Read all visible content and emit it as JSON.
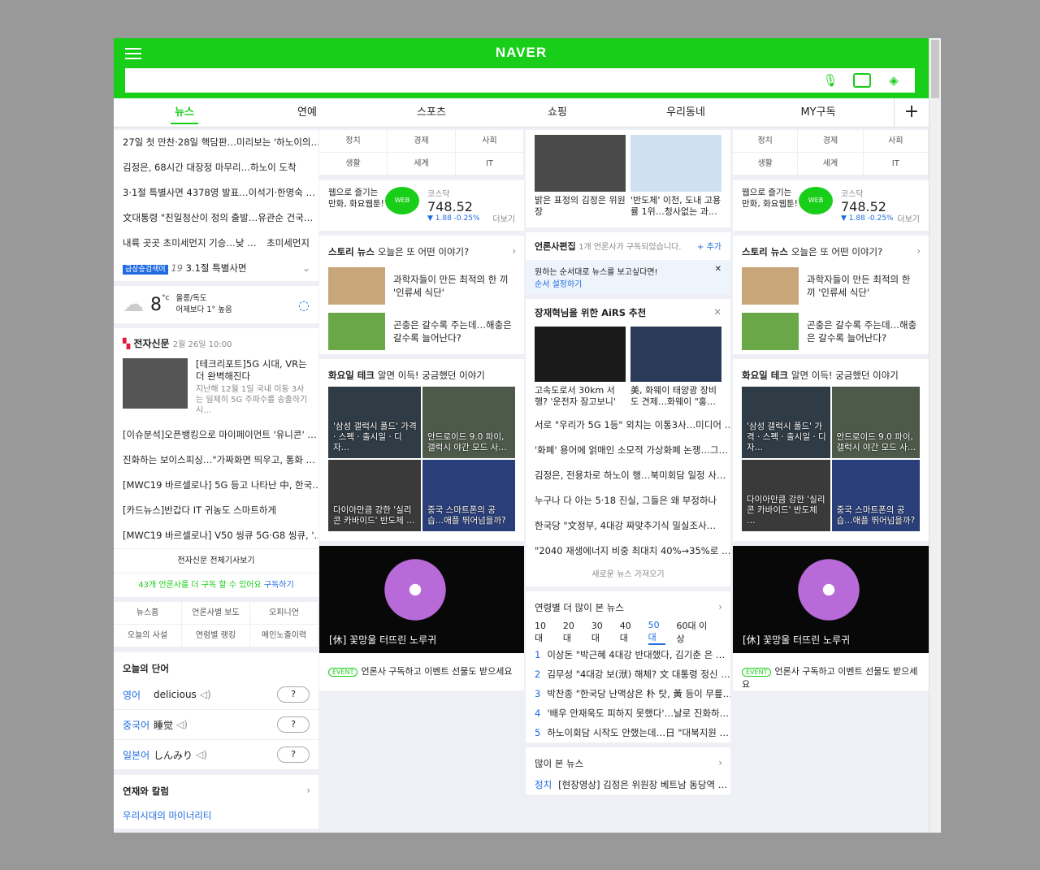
{
  "header": {
    "logo": "NAVER",
    "search_placeholder": ""
  },
  "tabs": [
    "뉴스",
    "연예",
    "스포츠",
    "쇼핑",
    "우리동네",
    "MY구독"
  ],
  "col1": {
    "headlines": [
      "27일 첫 만찬·28일 핵담판…미리보는 '하노이의…",
      "김정은, 68시간 대장정 마무리…하노이 도착",
      "3·1절 특별사면 4378명 발표…이석기·한명숙 …",
      "文대통령 \"친일청산이 정의 출발…유관순 건국…",
      "내륙 곳곳 초미세먼지 기승…낮 …"
    ],
    "side_tag": "초미세먼지",
    "rising_badge": "급상승검색어",
    "rising_rank": "19",
    "rising_text": "3.1절 특별사면",
    "weather": {
      "temp": "8",
      "unit": "°c",
      "place": "울릉/독도",
      "diff": "어제보다 1° 높음"
    },
    "press": {
      "name": "전자신문",
      "time": "2월 26일 10:00",
      "lead_title": "[테크리포트]5G 시대, VR는 더 완벽해진다",
      "lead_sub": "지난해 12월 1일 국내 이동 3사는 일제히 5G 주파수를 송출하기 시…",
      "items": [
        "[이슈분석]오픈뱅킹으로 마이페이먼트 '유니콘' …",
        "진화하는 보이스피싱…\"가짜화면 띄우고, 통화 …",
        "[MWC19 바르셀로나] 5G 등고 나타난 中, 한국…",
        "[카드뉴스]반갑다 IT 귀농도 스마트하게",
        "[MWC19 바르셀로나] V50 씽큐 5G·G8 씽큐, '…"
      ],
      "more": "전자신문 전체기사보기",
      "subscribe": "43개 언론사를 더 구독 할 수 있어요",
      "subscribe_link": "구독하기"
    },
    "menu": [
      "뉴스홈",
      "언론사별 보도",
      "오피니언",
      "오늘의 사설",
      "연령별 랭킹",
      "메인노출이력"
    ],
    "words_title": "오늘의 단어",
    "words": [
      {
        "lang": "영어",
        "word": "delicious"
      },
      {
        "lang": "중국어",
        "word": "睡觉"
      },
      {
        "lang": "일본어",
        "word": "しんみり"
      }
    ],
    "q": "?",
    "column_title": "연재와 칼럼",
    "column_item": "우리시대의 마이너리티"
  },
  "col2": {
    "cats": [
      "정치",
      "경제",
      "사회",
      "생활",
      "세계",
      "IT"
    ],
    "webtoon": "웹으로 즐기는 만화, 화요웹툰!",
    "kosdaq": {
      "label": "코스닥",
      "value": "748.52",
      "change": "▼ 1.88 -0.25%",
      "more": "더보기"
    },
    "story_title": "스토리 뉴스",
    "story_sub": "오늘은 또 어떤 이야기?",
    "stories": [
      "과학자들이 만든 최적의 한 끼 '인류세 식단'",
      "곤충은 갈수록 주는데…해충은 갈수록 늘어난다?"
    ],
    "tech_title": "화요일 테크",
    "tech_sub": "알면 이득! 궁금했던 이야기",
    "tiles": [
      "'삼성 갤럭시 폴드' 가격 · 스펙 · 출시일 · 디자…",
      "안드로이드 9.0 파이, 갤럭시 야간 모드 사…",
      "다이아만큼 강한 '실리콘 카바이드' 반도체 …",
      "중국 스마트폰의 공습…애플 뛰어넘을까?"
    ],
    "photo_caption": "[休] 꽃망울 터뜨린 노루귀",
    "event_tag": "EVENT",
    "event_text": "언론사 구독하고 이벤트 선물도 받으세요"
  },
  "col3": {
    "top": [
      "밝은 표정의 김정은 위원장",
      "'반도체' 이천, 도내 고용률 1위…청사없는 과…"
    ],
    "edit_title": "언론사편집",
    "edit_sub": "1개 언론사가 구독되었습니다.",
    "edit_add": "+ 추가",
    "edit_note": "원하는 순서대로 뉴스를 보고싶다면!",
    "edit_link": "순서 설정하기",
    "airs_title": "장재혁님을 위한 AiRS 추천",
    "airs_imgs": [
      "고속도로서 30km 서행? '운전자 잠고보니'",
      "美, 화웨이 태양광 장비도 견제…화웨이 \"홍…"
    ],
    "airs_list": [
      "서로 \"우리가 5G 1등\" 외치는 이통3사…미디어 …",
      "'화폐' 용어에 얽매인 소모적 가상화폐 논쟁…그…",
      "김정은, 전용차로 하노이 행…북미회담 일정 사…",
      "누구나 다 아는 5·18 진실, 그들은 왜 부정하나",
      "한국당 \"文정부, 4대강 짜맞추기식 밀실조사…",
      "\"2040 재생에너지 비중 최대치 40%→35%로 …"
    ],
    "more_news": "새로운 뉴스 가져오기",
    "age_title": "연령별 더 많이 본 뉴스",
    "ages": [
      "10대",
      "20대",
      "30대",
      "40대",
      "50대",
      "60대 이상"
    ],
    "age_list": [
      "이상돈 \"박근혜 4대강 반대했다, 김기춘 은 …",
      "김무성 \"4대강 보(洑) 해체? 文 대통령 정신 …",
      "박찬종 \"한국당 난맥상은 朴 탓, 黃 등이 무릎…",
      "'배우 안재욱도 피하지 못했다'…날로 진화하…",
      "하노이회담 시작도 안했는데…日 \"대북지원 …"
    ],
    "most_title": "많이 본 뉴스",
    "most_cat": "정치",
    "most_item": "[현장영상] 김정은 위원장 베트남 동당역 …"
  },
  "colors": {
    "brand": "#19ce19",
    "link": "#1f6be0",
    "kosdaq_down": "#1f6be0"
  }
}
